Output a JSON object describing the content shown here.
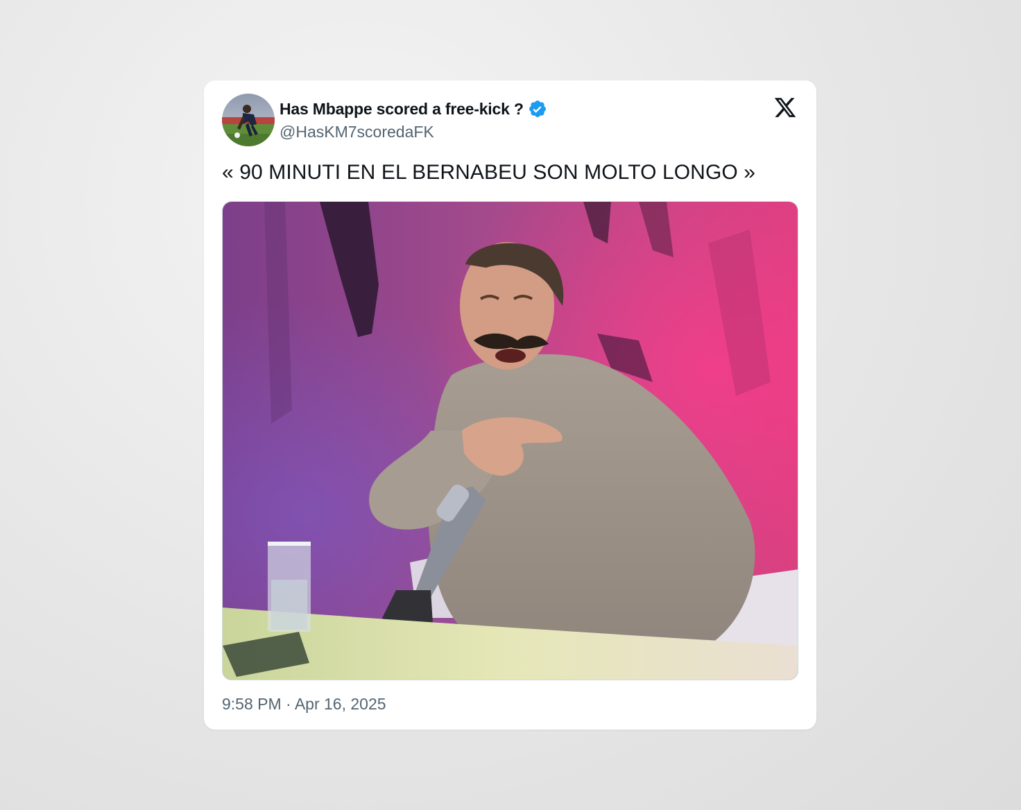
{
  "tweet": {
    "display_name": "Has Mbappe scored a free-kick ?",
    "handle": "@HasKM7scoredaFK",
    "text": "« 90 MINUTI EN EL BERNABEU SON MOLTO LONGO »",
    "timestamp": "9:58 PM · Apr 16, 2025",
    "verified": true
  },
  "icons": {
    "verified": "verified-badge-icon",
    "platform_logo": "x-logo-icon",
    "avatar": "profile-avatar"
  },
  "colors": {
    "verified_blue": "#1d9bf0",
    "text_primary": "#0f1419",
    "text_secondary": "#536471",
    "card_background": "#ffffff"
  }
}
